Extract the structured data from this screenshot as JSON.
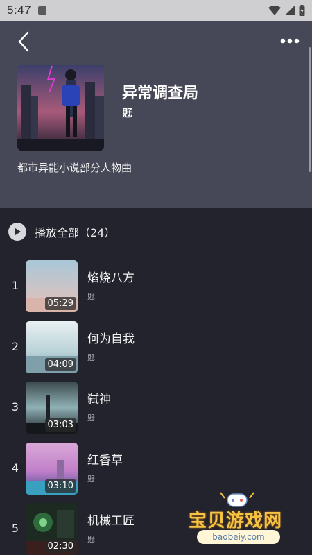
{
  "status": {
    "time": "5:47"
  },
  "album": {
    "title": "异常调查局",
    "artist": "覎",
    "description": "都市异能小说部分人物曲"
  },
  "play_all": {
    "label": "播放全部（24）"
  },
  "tracks": [
    {
      "num": "1",
      "name": "焰烧八方",
      "artist": "覎",
      "duration": "05:29"
    },
    {
      "num": "2",
      "name": "何为自我",
      "artist": "覎",
      "duration": "04:09"
    },
    {
      "num": "3",
      "name": "弑神",
      "artist": "覎",
      "duration": "03:03"
    },
    {
      "num": "4",
      "name": "红香草",
      "artist": "覎",
      "duration": "03:10"
    },
    {
      "num": "5",
      "name": "机械工匠",
      "artist": "覎",
      "duration": "02:30"
    }
  ],
  "watermark": {
    "text": "宝贝游戏网",
    "url": "baobeiy.com"
  },
  "colors": {
    "header_bg": "#474857",
    "list_bg": "#22232d",
    "accent": "#f6c343"
  }
}
